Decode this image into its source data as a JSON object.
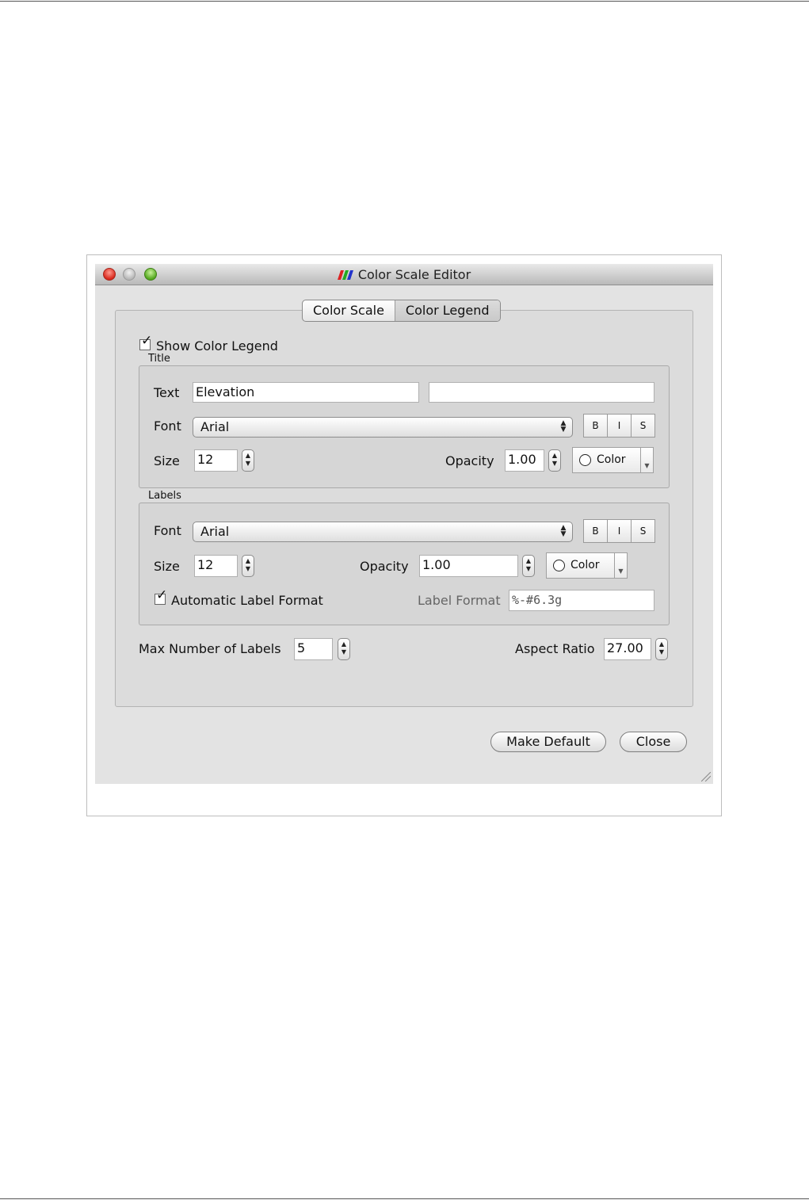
{
  "window": {
    "title": "Color Scale Editor",
    "app_icon": "paraview-logo-icon"
  },
  "tabs": [
    {
      "label": "Color Scale",
      "active": false
    },
    {
      "label": "Color Legend",
      "active": true
    }
  ],
  "show_legend": {
    "label": "Show Color Legend",
    "checked": true
  },
  "title_group": {
    "label": "Title",
    "text_label": "Text",
    "text_value": "Elevation",
    "text_value2": "",
    "font_label": "Font",
    "font_value": "Arial",
    "style_buttons": [
      "B",
      "I",
      "S"
    ],
    "size_label": "Size",
    "size_value": "12",
    "opacity_label": "Opacity",
    "opacity_value": "1.00",
    "color_label": "Color",
    "color_value": "#ffffff"
  },
  "labels_group": {
    "label": "Labels",
    "font_label": "Font",
    "font_value": "Arial",
    "style_buttons": [
      "B",
      "I",
      "S"
    ],
    "size_label": "Size",
    "size_value": "12",
    "opacity_label": "Opacity",
    "opacity_value": "1.00",
    "color_label": "Color",
    "color_value": "#ffffff",
    "auto_format_label": "Automatic Label Format",
    "auto_format_checked": true,
    "label_format_label": "Label Format",
    "label_format_value": "%-#6.3g"
  },
  "max_labels": {
    "label": "Max Number of Labels",
    "value": "5"
  },
  "aspect_ratio": {
    "label": "Aspect Ratio",
    "value": "27.00"
  },
  "buttons": {
    "make_default": "Make Default",
    "close": "Close"
  }
}
